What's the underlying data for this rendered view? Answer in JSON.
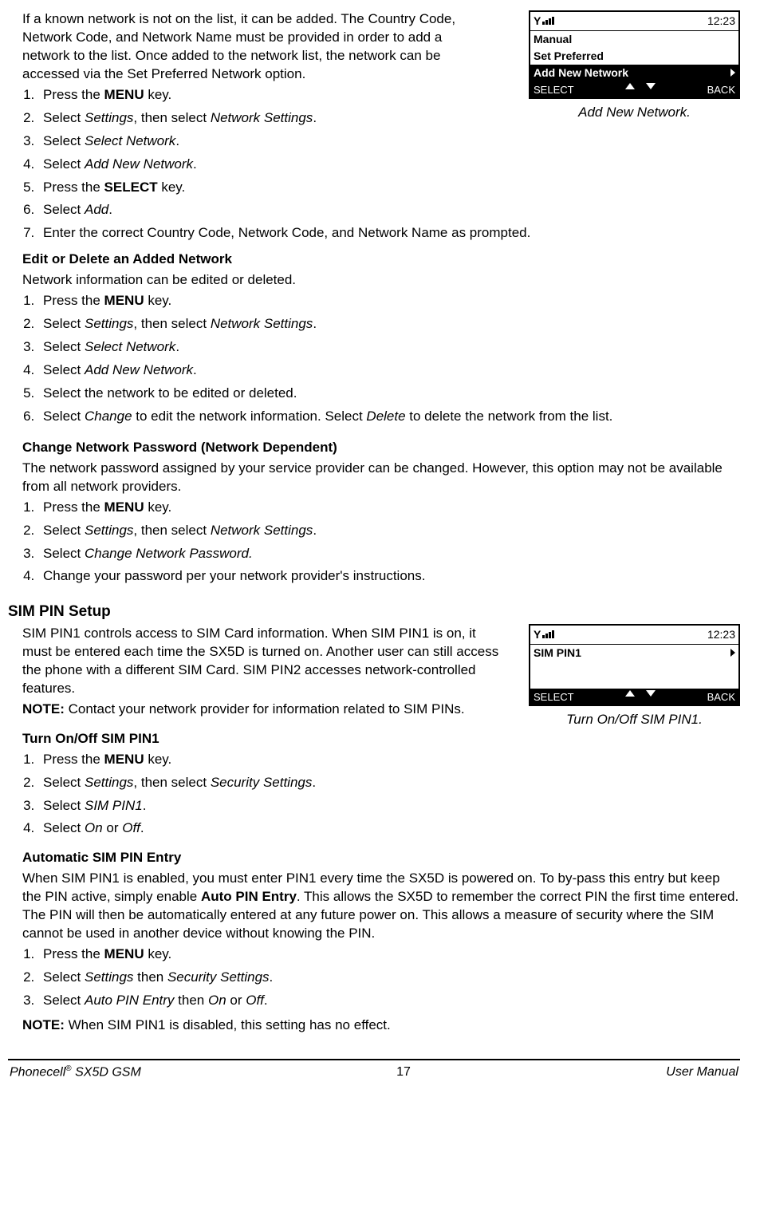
{
  "intro_para": "If a known network is not on the list, it can be added. The Country Code, Network Code, and Network Name must be provided in order to add a network to the list. Once added to the network list, the network can be accessed via the Set Preferred Network option.",
  "fig1": {
    "time": "12:23",
    "row1": "Manual",
    "row2": "Set Preferred",
    "row3": "Add New Network",
    "sk_left": "SELECT",
    "sk_right": "BACK",
    "caption": "Add New Network."
  },
  "list1": {
    "i1a": "Press the ",
    "i1b": "MENU",
    "i1c": " key.",
    "i2a": "Select ",
    "i2b": "Settings",
    "i2c": ", then select ",
    "i2d": "Network Settings",
    "i2e": ".",
    "i3a": "Select ",
    "i3b": "Select Network",
    "i3c": ".",
    "i4a": "Select ",
    "i4b": "Add New Network",
    "i4c": ".",
    "i5a": "Press the ",
    "i5b": "SELECT",
    "i5c": " key.",
    "i6a": "Select ",
    "i6b": "Add",
    "i6c": ".",
    "i7": "Enter the correct Country Code, Network Code, and Network Name as prompted."
  },
  "edit_heading": "Edit or Delete an Added Network",
  "edit_para": "Network information can be edited or deleted.",
  "list2": {
    "i1a": "Press the ",
    "i1b": "MENU",
    "i1c": " key.",
    "i2a": "Select ",
    "i2b": "Settings",
    "i2c": ", then select ",
    "i2d": "Network Settings",
    "i2e": ".",
    "i3a": "Select ",
    "i3b": "Select Network",
    "i3c": ".",
    "i4a": "Select ",
    "i4b": "Add New Network",
    "i4c": ".",
    "i5": "Select the network to be edited or deleted.",
    "i6a": "Select ",
    "i6b": "Change",
    "i6c": " to edit the network information. Select ",
    "i6d": "Delete",
    "i6e": " to delete the network from the list."
  },
  "chpw_heading": "Change Network Password (Network Dependent)",
  "chpw_para": "The network password assigned by your service provider can be changed. However, this option may not be available from all network providers.",
  "list3": {
    "i1a": "Press the ",
    "i1b": "MENU",
    "i1c": " key.",
    "i2a": "Select ",
    "i2b": "Settings",
    "i2c": ", then select ",
    "i2d": "Network Settings",
    "i2e": ".",
    "i3a": "Select ",
    "i3b": "Change Network Password.",
    "i4": "Change your password per your network provider's instructions."
  },
  "sim_heading": "SIM PIN Setup",
  "sim_para": "SIM PIN1 controls access to SIM Card information. When SIM PIN1 is on, it must be entered each time the SX5D is turned on. Another user can still access the phone with a different SIM Card. SIM PIN2 accesses network-controlled features.",
  "note_label": "NOTE:",
  "sim_note": " Contact your network provider for information related to SIM PINs.",
  "fig2": {
    "time": "12:23",
    "row1": "SIM PIN1",
    "sk_left": "SELECT",
    "sk_right": "BACK",
    "caption": "Turn On/Off SIM PIN1."
  },
  "onoff_heading": "Turn On/Off SIM PIN1",
  "list4": {
    "i1a": "Press the ",
    "i1b": "MENU",
    "i1c": " key.",
    "i2a": "Select ",
    "i2b": "Settings",
    "i2c": ", then select ",
    "i2d": "Security Settings",
    "i2e": ".",
    "i3a": "Select ",
    "i3b": "SIM PIN1",
    "i3c": ".",
    "i4a": "Select ",
    "i4b": "On",
    "i4c": " or ",
    "i4d": "Off",
    "i4e": "."
  },
  "auto_heading": "Automatic SIM PIN Entry",
  "auto_para1": "When SIM PIN1 is enabled, you must enter PIN1 every time the SX5D is powered on. To by-pass this entry but keep the PIN active, simply enable ",
  "auto_para_bold": "Auto PIN Entry",
  "auto_para2": ". This allows the SX5D to remember the correct PIN the first time entered. The PIN will then be automatically entered at any future power on. This allows a measure of security where the SIM cannot be used in another device without knowing the PIN.",
  "list5": {
    "i1a": "Press the ",
    "i1b": "MENU",
    "i1c": " key.",
    "i2a": "Select ",
    "i2b": "Settings",
    "i2c": " then ",
    "i2d": "Security Settings",
    "i2e": ".",
    "i3a": "Select ",
    "i3b": "Auto PIN Entry",
    "i3c": " then ",
    "i3d": "On",
    "i3e": " or ",
    "i3f": "Off",
    "i3g": "."
  },
  "auto_note": " When SIM PIN1 is disabled, this setting has no effect.",
  "footer": {
    "left1": "Phonecell",
    "left2": " SX5D GSM",
    "center": "17",
    "right": "User Manual"
  }
}
